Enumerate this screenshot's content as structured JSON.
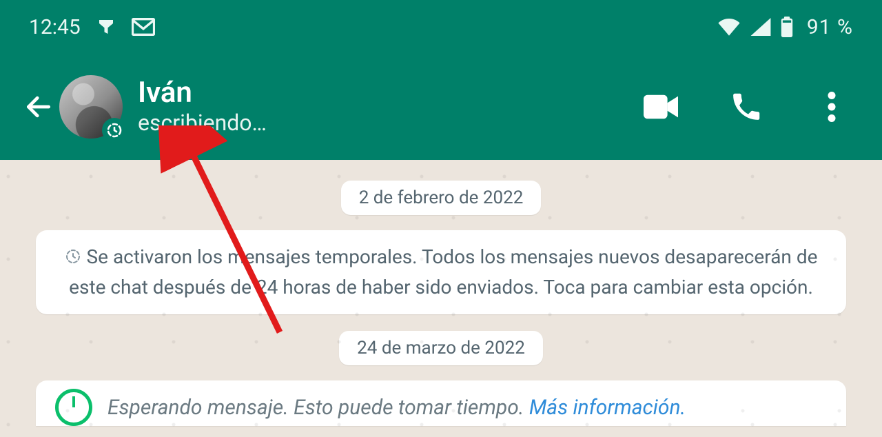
{
  "status_bar": {
    "time": "12:45",
    "battery_pct": "91 %"
  },
  "header": {
    "contact_name": "Iván",
    "contact_status": "escribiendo…"
  },
  "chat": {
    "date1": "2 de febrero de 2022",
    "system_msg": "Se activaron los mensajes temporales. Todos los mensajes nuevos desaparecerán de este chat después de 24 horas de haber sido enviados. Toca para cambiar esta opción.",
    "date2": "24 de marzo de 2022",
    "waiting_text": "Esperando mensaje. Esto puede tomar tiempo. ",
    "waiting_link": "Más información."
  }
}
